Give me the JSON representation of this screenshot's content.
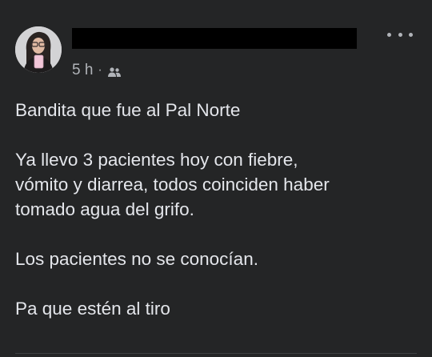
{
  "post": {
    "author_name": "",
    "timestamp": "5 h",
    "separator": "·",
    "audience_icon": "friends-icon",
    "more_icon": "more-options-icon",
    "body": {
      "line1": "Bandita que fue al Pal Norte",
      "line2a": "Ya llevo 3 pacientes hoy con fiebre,",
      "line2b": "vómito y diarrea, todos coinciden haber",
      "line2c": "tomado agua del grifo.",
      "line3": "Los pacientes no se conocían.",
      "line4": "Pa que estén al tiro"
    }
  },
  "colors": {
    "background": "#242526",
    "text": "#e4e6eb",
    "secondary_text": "#b0b3b8"
  }
}
